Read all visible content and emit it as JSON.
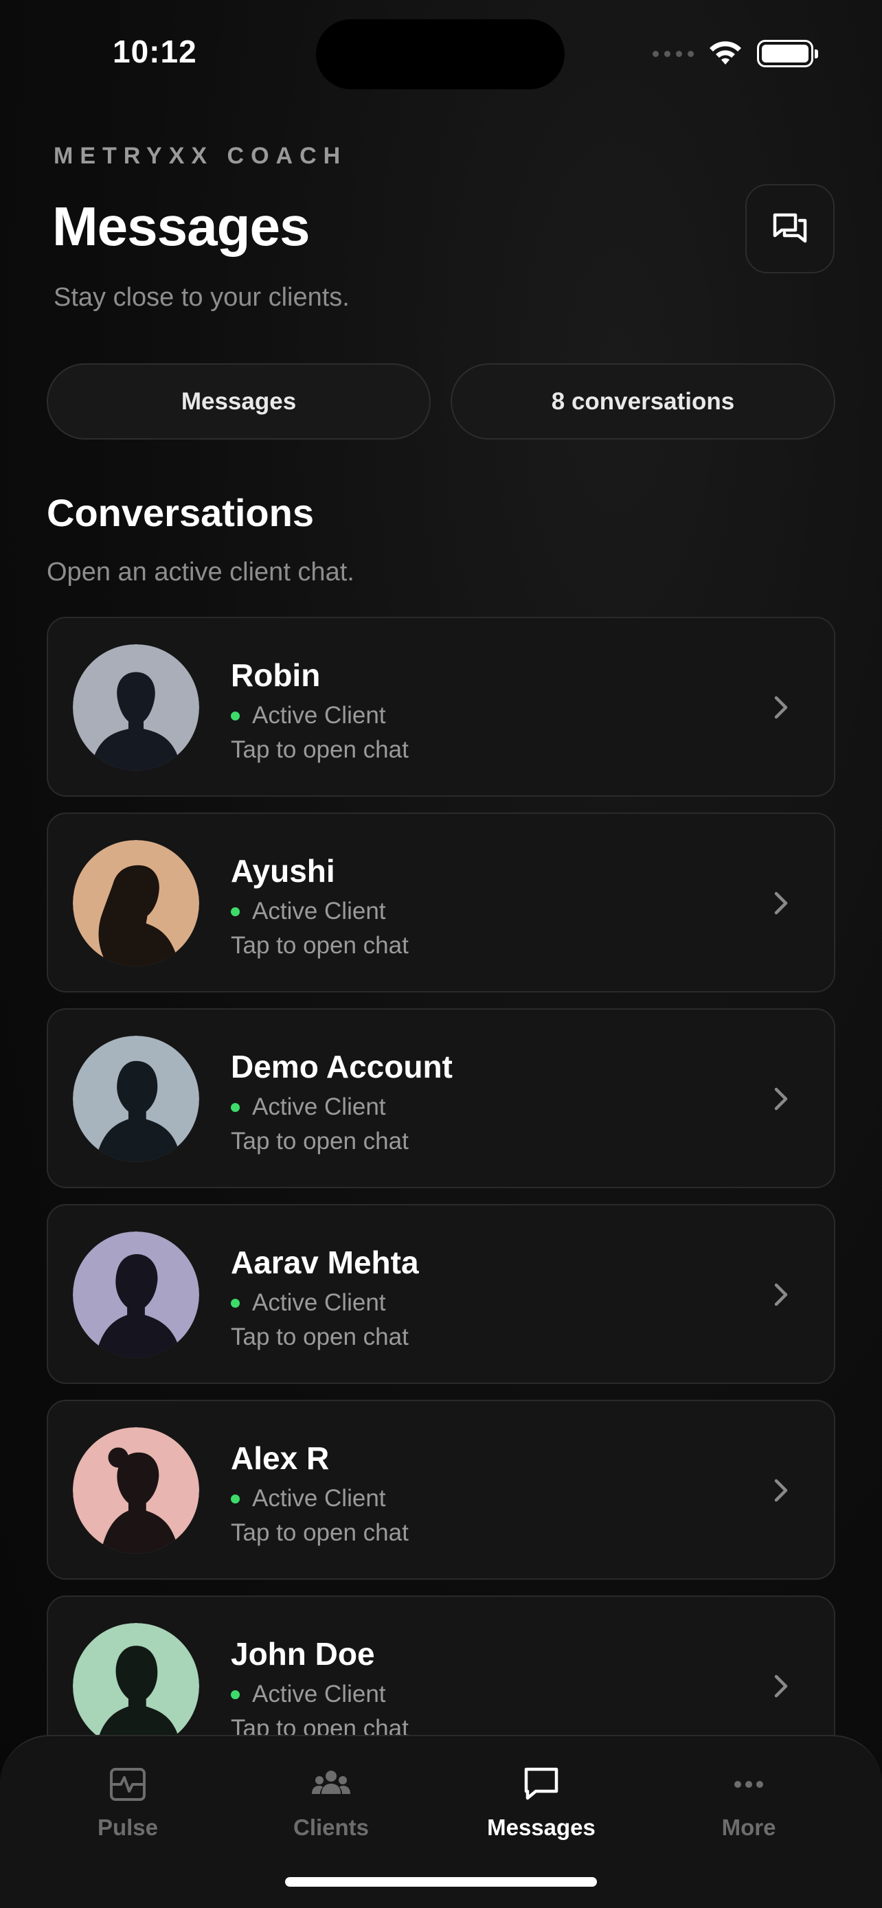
{
  "status_bar": {
    "time": "10:12"
  },
  "header": {
    "brand": "METRYXX COACH",
    "title": "Messages",
    "subtitle": "Stay close to your clients."
  },
  "pills": {
    "left": "Messages",
    "right": "8 conversations"
  },
  "section": {
    "title": "Conversations",
    "subtitle": "Open an active client chat."
  },
  "conversations": [
    {
      "name": "Robin",
      "status": "Active Client",
      "hint": "Tap to open chat",
      "avatar_bg": "#a9aeb8"
    },
    {
      "name": "Ayushi",
      "status": "Active Client",
      "hint": "Tap to open chat",
      "avatar_bg": "#d9ac88"
    },
    {
      "name": "Demo Account",
      "status": "Active Client",
      "hint": "Tap to open chat",
      "avatar_bg": "#a7b3bd"
    },
    {
      "name": "Aarav Mehta",
      "status": "Active Client",
      "hint": "Tap to open chat",
      "avatar_bg": "#a9a3c6"
    },
    {
      "name": "Alex R",
      "status": "Active Client",
      "hint": "Tap to open chat",
      "avatar_bg": "#e8b5b0"
    },
    {
      "name": "John Doe",
      "status": "Active Client",
      "hint": "Tap to open chat",
      "avatar_bg": "#a8d4b7"
    }
  ],
  "tabs": [
    {
      "label": "Pulse",
      "icon": "pulse-icon"
    },
    {
      "label": "Clients",
      "icon": "users-icon"
    },
    {
      "label": "Messages",
      "icon": "chat-icon",
      "active": true
    },
    {
      "label": "More",
      "icon": "more-icon"
    }
  ],
  "colors": {
    "active_dot": "#3ddc6a",
    "card_bg": "#151515",
    "background": "#0c0c0c"
  }
}
